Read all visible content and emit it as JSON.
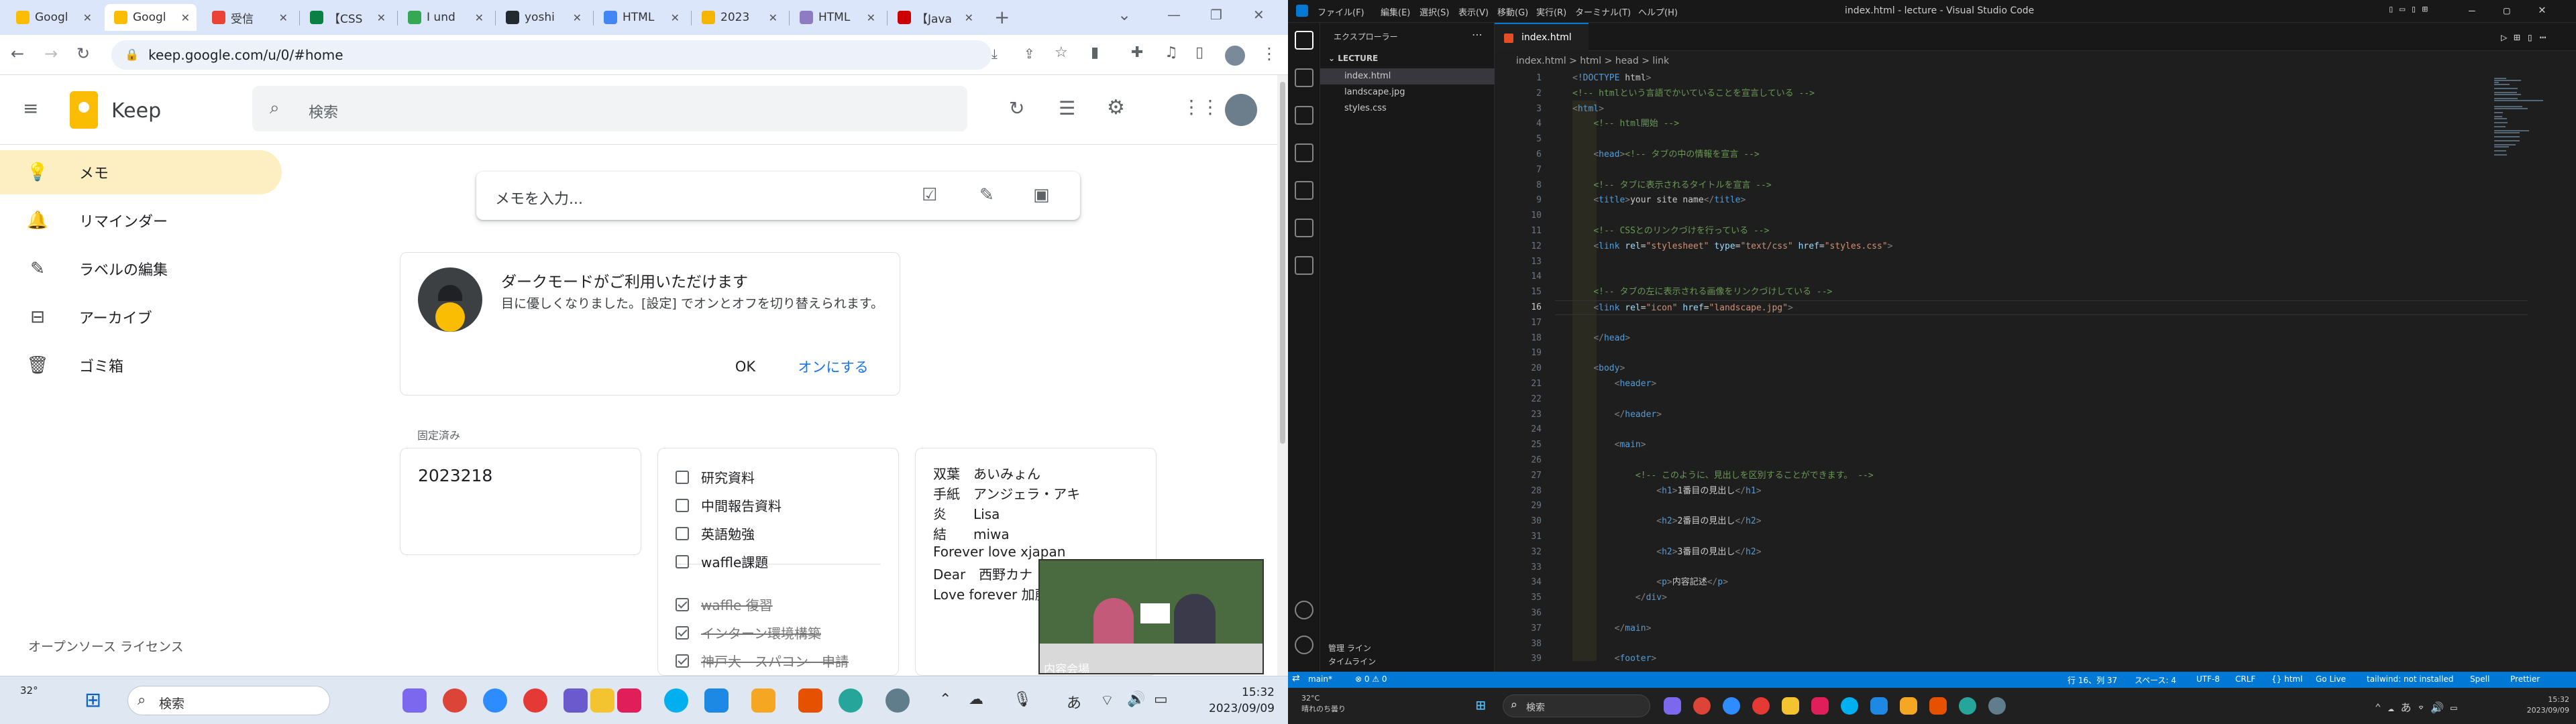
{
  "chrome": {
    "tabs": [
      {
        "label": "Googl",
        "color": "#fbbc04"
      },
      {
        "label": "Googl",
        "color": "#fbbc04"
      },
      {
        "label": "受信",
        "color": "#ea4335"
      },
      {
        "label": "【CSS",
        "color": "#0b8043"
      },
      {
        "label": "I und",
        "color": "#34a853"
      },
      {
        "label": "yoshi",
        "color": "#24292f"
      },
      {
        "label": "HTML",
        "color": "#4285f4"
      },
      {
        "label": "2023",
        "color": "#f4b400"
      },
      {
        "label": "HTML",
        "color": "#8e7cc3"
      },
      {
        "label": "【Java",
        "color": "#cc0000"
      }
    ],
    "url": "keep.google.com/u/0/#home"
  },
  "keep": {
    "app_name": "Keep",
    "search_placeholder": "検索",
    "sidebar": [
      {
        "label": "メモ",
        "icon": "lightbulb-icon",
        "glyph": "💡"
      },
      {
        "label": "リマインダー",
        "icon": "bell-icon",
        "glyph": "🔔"
      },
      {
        "label": "ラベルの編集",
        "icon": "pencil-icon",
        "glyph": "✎"
      },
      {
        "label": "アーカイブ",
        "icon": "archive-icon",
        "glyph": "⊟"
      },
      {
        "label": "ゴミ箱",
        "icon": "trash-icon",
        "glyph": "🗑"
      }
    ],
    "license": "オープンソース ライセンス",
    "note_placeholder": "メモを入力...",
    "dark_mode": {
      "title": "ダークモードがご利用いただけます",
      "body": "目に優しくなりました。[設定] でオンとオフを切り替えられます。",
      "ok": "OK",
      "turn_on": "オンにする"
    },
    "pinned_label": "固定済み",
    "card1_title": "2023218",
    "checklist": [
      {
        "text": "研究資料",
        "done": false
      },
      {
        "text": "中間報告資料",
        "done": false
      },
      {
        "text": "英語勉強",
        "done": false
      },
      {
        "text": "waffle課題",
        "done": false
      },
      {
        "text": "waffle 復習",
        "done": true
      },
      {
        "text": "インターン環境構築",
        "done": true
      },
      {
        "text": "神戸大　スパコン　申請",
        "done": true
      }
    ],
    "card3_lines": [
      "双葉　あいみょん",
      "手紙　アンジェラ・アキ",
      "炎　　Lisa",
      "結　　miwa",
      "Forever love xjapan",
      "Dear　西野カナ",
      "Love forever 加藤"
    ],
    "video_caption": "内容会場"
  },
  "taskbar_left": {
    "weather": "32°",
    "search": "検索",
    "time": "15:32",
    "date": "2023/09/09"
  },
  "vscode": {
    "menu": [
      "ファイル(F)",
      "編集(E)",
      "選択(S)",
      "表示(V)",
      "移動(G)",
      "実行(R)",
      "ターミナル(T)",
      "ヘルプ(H)"
    ],
    "window_title": "index.html - lecture - Visual Studio Code",
    "explorer_title": "エクスプローラー",
    "folder": "LECTURE",
    "files": [
      "index.html",
      "landscape.jpg",
      "styles.css"
    ],
    "explorer_bottom1": "管理 ライン",
    "explorer_bottom2": "タイムライン",
    "tab": "index.html",
    "breadcrumb": "index.html > html > head > link",
    "code": [
      "<!DOCTYPE html>",
      "<!-- htmlという言語でかいていることを宣言している -->",
      "<html>",
      "    <!-- html開始 -->",
      "",
      "    <head><!-- タブの中の情報を宣言 -->",
      "",
      "    <!-- タブに表示されるタイトルを宣言 -->",
      "    <title>your site name</title>",
      "",
      "    <!-- CSSとのリンクづけを行っている -->",
      "    <link rel=\"stylesheet\" type=\"text/css\" href=\"styles.css\">",
      "",
      "",
      "    <!-- タブの左に表示される画像をリンクづけしている -->",
      "    <link rel=\"icon\" href=\"landscape.jpg\">",
      "",
      "    </head>",
      "",
      "    <body>",
      "        <header>",
      "",
      "        </header>",
      "",
      "        <main>",
      "",
      "            <!-- このように、見出しを区別することができます。 -->",
      "                <h1>1番目の見出し</h1>",
      "",
      "                <h2>2番目の見出し</h2>",
      "",
      "                <h2>3番目の見出し</h2>",
      "",
      "                <p>内容記述</p>",
      "            </div>",
      "",
      "        </main>",
      "",
      "        <footer>"
    ],
    "current_line": 16,
    "status_left": [
      "main*",
      "⊗ 0 ⚠ 0"
    ],
    "status_right": [
      "行 16、列 37",
      "スペース: 4",
      "UTF-8",
      "CRLF",
      "{} html",
      "Go Live",
      "tailwind: not installed",
      "Spell",
      "Prettier"
    ]
  },
  "taskbar_right": {
    "weather_temp": "32°C",
    "weather_text": "晴れのち曇り",
    "search": "検索",
    "time": "15:32",
    "date": "2023/09/09"
  }
}
